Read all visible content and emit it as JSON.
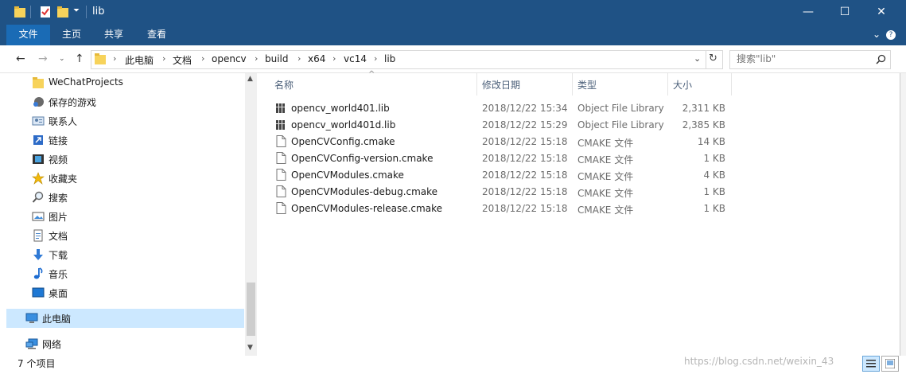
{
  "window": {
    "title": "lib",
    "minimize_glyph": "—",
    "maximize_glyph": "☐",
    "close_glyph": "✕"
  },
  "ribbon": {
    "tabs": [
      "文件",
      "主页",
      "共享",
      "查看"
    ],
    "collapse_glyph": "⌄",
    "help_glyph": "?"
  },
  "address": {
    "crumbs": [
      "此电脑",
      "文档",
      "opencv",
      "build",
      "x64",
      "vc14",
      "lib"
    ],
    "search_placeholder": "搜索\"lib\""
  },
  "nav": {
    "items": [
      {
        "label": "WeChatProjects",
        "icon": "folder-icon"
      },
      {
        "label": "保存的游戏",
        "icon": "saved-games-icon"
      },
      {
        "label": "联系人",
        "icon": "contacts-icon"
      },
      {
        "label": "链接",
        "icon": "links-icon"
      },
      {
        "label": "视频",
        "icon": "video-icon"
      },
      {
        "label": "收藏夹",
        "icon": "favorites-icon"
      },
      {
        "label": "搜索",
        "icon": "search-icon"
      },
      {
        "label": "图片",
        "icon": "pictures-icon"
      },
      {
        "label": "文档",
        "icon": "documents-icon"
      },
      {
        "label": "下载",
        "icon": "download-icon"
      },
      {
        "label": "音乐",
        "icon": "music-icon"
      },
      {
        "label": "桌面",
        "icon": "desktop-icon"
      },
      {
        "label": "此电脑",
        "icon": "this-pc-icon"
      },
      {
        "label": "网络",
        "icon": "network-icon"
      }
    ]
  },
  "columns": {
    "name": "名称",
    "date": "修改日期",
    "type": "类型",
    "size": "大小"
  },
  "files": [
    {
      "name": "opencv_world401.lib",
      "date": "2018/12/22 15:34",
      "type": "Object File Library",
      "size": "2,311 KB",
      "icon": "library-file-icon"
    },
    {
      "name": "opencv_world401d.lib",
      "date": "2018/12/22 15:29",
      "type": "Object File Library",
      "size": "2,385 KB",
      "icon": "library-file-icon"
    },
    {
      "name": "OpenCVConfig.cmake",
      "date": "2018/12/22 15:18",
      "type": "CMAKE 文件",
      "size": "14 KB",
      "icon": "file-icon"
    },
    {
      "name": "OpenCVConfig-version.cmake",
      "date": "2018/12/22 15:18",
      "type": "CMAKE 文件",
      "size": "1 KB",
      "icon": "file-icon"
    },
    {
      "name": "OpenCVModules.cmake",
      "date": "2018/12/22 15:18",
      "type": "CMAKE 文件",
      "size": "4 KB",
      "icon": "file-icon"
    },
    {
      "name": "OpenCVModules-debug.cmake",
      "date": "2018/12/22 15:18",
      "type": "CMAKE 文件",
      "size": "1 KB",
      "icon": "file-icon"
    },
    {
      "name": "OpenCVModules-release.cmake",
      "date": "2018/12/22 15:18",
      "type": "CMAKE 文件",
      "size": "1 KB",
      "icon": "file-icon"
    }
  ],
  "status": {
    "item_count": "7 个项目",
    "watermark": "https://blog.csdn.net/weixin_43"
  },
  "colors": {
    "titlebar": "#1f5285",
    "file_tab": "#1a6bb5",
    "selected": "#cce8ff"
  }
}
